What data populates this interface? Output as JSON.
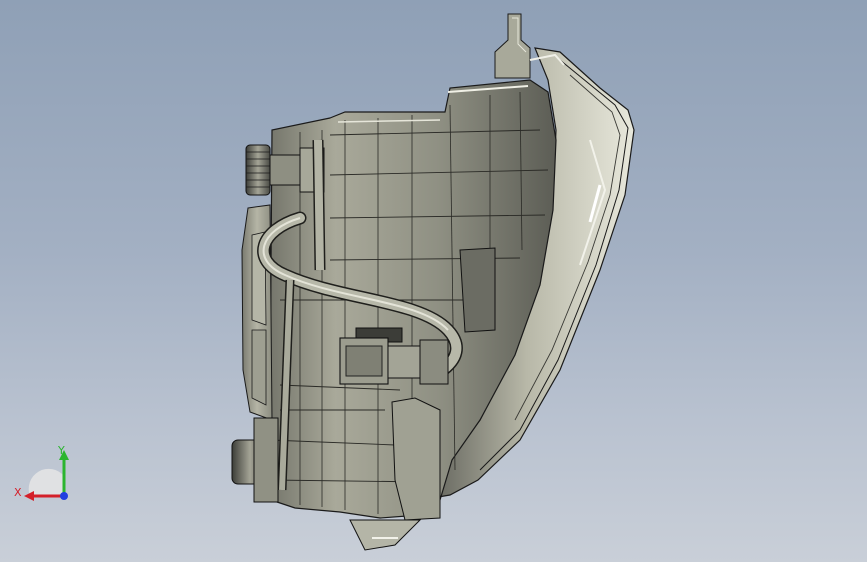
{
  "triad": {
    "x_label": "X",
    "y_label": "Y",
    "x_color": "#d4202a",
    "y_color": "#2bb52f",
    "z_color": "#2040e0"
  },
  "colors": {
    "background_top": "#8fa0b6",
    "background_bottom": "#c9cfd8",
    "body_fill": "#9a9b8c",
    "body_light": "#c9c8b8",
    "body_dark": "#55564e",
    "edge": "#1a1a1a"
  },
  "view": {
    "subject": "headlamp-assembly-side-view",
    "icons": [
      "cad-model",
      "axis-triad-icon"
    ]
  }
}
